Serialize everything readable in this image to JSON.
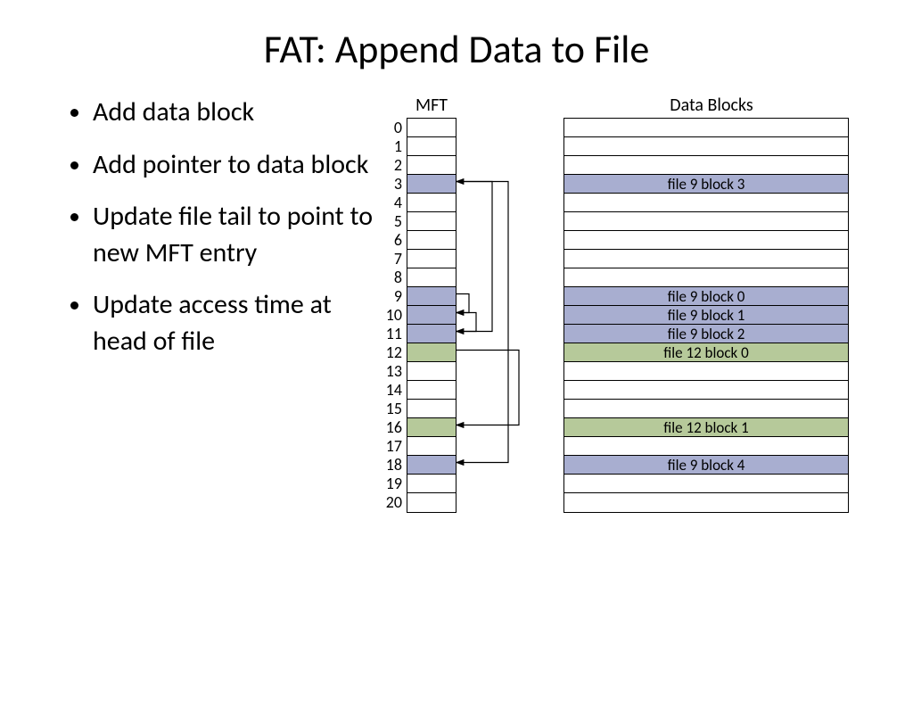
{
  "title": "FAT: Append Data to File",
  "bullets": [
    "Add data block",
    "Add pointer to data block",
    "Update file tail to point to new MFT entry",
    "Update access time at head of file"
  ],
  "mft": {
    "title": "MFT",
    "rows": [
      {
        "idx": "0",
        "color": ""
      },
      {
        "idx": "1",
        "color": ""
      },
      {
        "idx": "2",
        "color": ""
      },
      {
        "idx": "3",
        "color": "blue"
      },
      {
        "idx": "4",
        "color": ""
      },
      {
        "idx": "5",
        "color": ""
      },
      {
        "idx": "6",
        "color": ""
      },
      {
        "idx": "7",
        "color": ""
      },
      {
        "idx": "8",
        "color": ""
      },
      {
        "idx": "9",
        "color": "blue"
      },
      {
        "idx": "10",
        "color": "blue"
      },
      {
        "idx": "11",
        "color": "blue"
      },
      {
        "idx": "12",
        "color": "green"
      },
      {
        "idx": "13",
        "color": ""
      },
      {
        "idx": "14",
        "color": ""
      },
      {
        "idx": "15",
        "color": ""
      },
      {
        "idx": "16",
        "color": "green"
      },
      {
        "idx": "17",
        "color": ""
      },
      {
        "idx": "18",
        "color": "blue"
      },
      {
        "idx": "19",
        "color": ""
      },
      {
        "idx": "20",
        "color": ""
      }
    ]
  },
  "data_blocks": {
    "title": "Data Blocks",
    "rows": [
      {
        "label": "",
        "color": ""
      },
      {
        "label": "",
        "color": ""
      },
      {
        "label": "",
        "color": ""
      },
      {
        "label": "file 9 block 3",
        "color": "blue"
      },
      {
        "label": "",
        "color": ""
      },
      {
        "label": "",
        "color": ""
      },
      {
        "label": "",
        "color": ""
      },
      {
        "label": "",
        "color": ""
      },
      {
        "label": "",
        "color": ""
      },
      {
        "label": "file 9 block 0",
        "color": "blue"
      },
      {
        "label": "file 9 block 1",
        "color": "blue"
      },
      {
        "label": "file 9 block 2",
        "color": "blue"
      },
      {
        "label": "file 12 block 0",
        "color": "green"
      },
      {
        "label": "",
        "color": ""
      },
      {
        "label": "",
        "color": ""
      },
      {
        "label": "",
        "color": ""
      },
      {
        "label": "file 12 block 1",
        "color": "green"
      },
      {
        "label": "",
        "color": ""
      },
      {
        "label": "file 9 block 4",
        "color": "blue"
      },
      {
        "label": "",
        "color": ""
      },
      {
        "label": "",
        "color": ""
      }
    ]
  },
  "arrows": [
    {
      "from": 9,
      "to": 10,
      "offset": 14
    },
    {
      "from": 10,
      "to": 11,
      "offset": 22
    },
    {
      "from": 11,
      "to": 3,
      "offset": 40
    },
    {
      "from": 3,
      "to": 18,
      "offset": 58
    },
    {
      "from": 12,
      "to": 16,
      "offset": 70
    }
  ],
  "chart_data": {
    "type": "table",
    "mft_entries": 21,
    "files": [
      {
        "name": "file 9",
        "mft_chain": [
          9,
          10,
          11,
          3,
          18
        ],
        "blocks": [
          "block 0",
          "block 1",
          "block 2",
          "block 3",
          "block 4"
        ]
      },
      {
        "name": "file 12",
        "mft_chain": [
          12,
          16
        ],
        "blocks": [
          "block 0",
          "block 1"
        ]
      }
    ]
  }
}
